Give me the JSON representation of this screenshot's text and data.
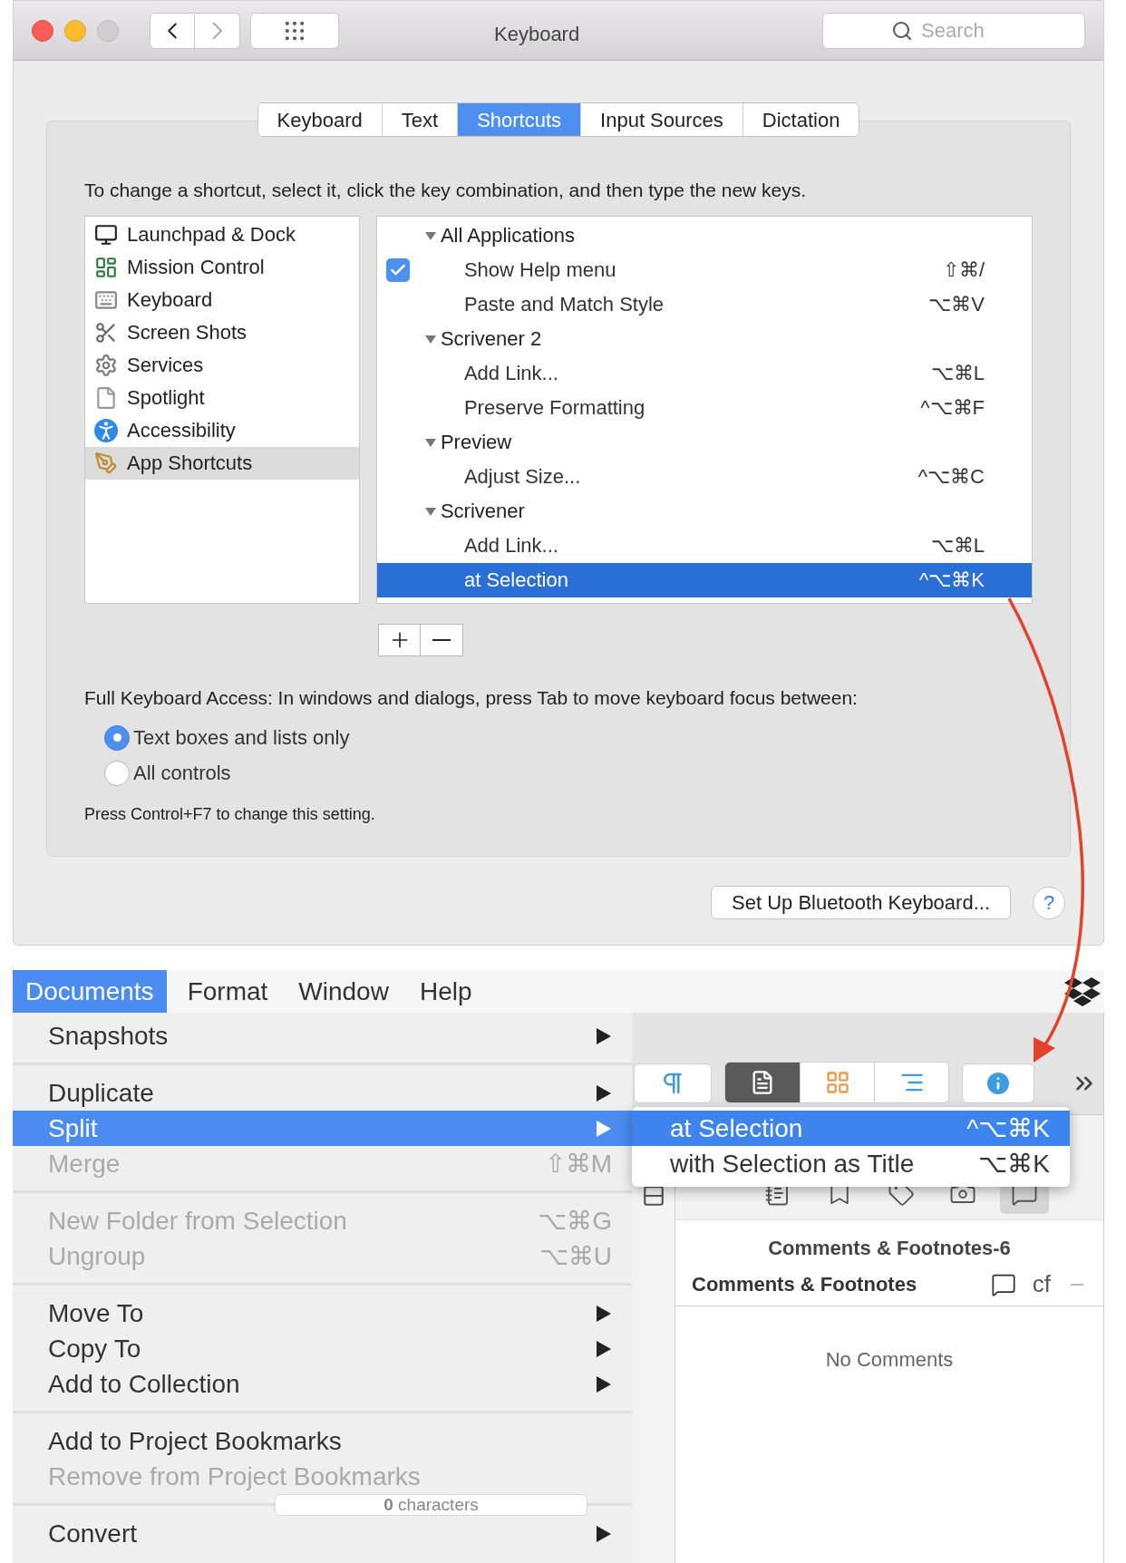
{
  "window": {
    "title": "Keyboard",
    "search": {
      "placeholder": "Search"
    }
  },
  "tabs": [
    {
      "label": "Keyboard",
      "selected": false
    },
    {
      "label": "Text",
      "selected": false
    },
    {
      "label": "Shortcuts",
      "selected": true
    },
    {
      "label": "Input Sources",
      "selected": false
    },
    {
      "label": "Dictation",
      "selected": false
    }
  ],
  "instructions": "To change a shortcut, select it, click the key combination, and then type the new keys.",
  "categories": [
    {
      "label": "Launchpad & Dock",
      "selected": false
    },
    {
      "label": "Mission Control",
      "selected": false
    },
    {
      "label": "Keyboard",
      "selected": false
    },
    {
      "label": "Screen Shots",
      "selected": false
    },
    {
      "label": "Services",
      "selected": false
    },
    {
      "label": "Spotlight",
      "selected": false
    },
    {
      "label": "Accessibility",
      "selected": false
    },
    {
      "label": "App Shortcuts",
      "selected": true
    }
  ],
  "shortcuts": [
    {
      "label": "All Applications",
      "expanded": true,
      "children": [
        {
          "label": "Show Help menu",
          "keys": "⇧⌘/",
          "checked": true,
          "selected": false
        },
        {
          "label": "Paste and Match Style",
          "keys": "⌥⌘V",
          "checked": false,
          "selected": false
        }
      ]
    },
    {
      "label": "Scrivener 2",
      "expanded": true,
      "children": [
        {
          "label": "Add Link...",
          "keys": "⌥⌘L",
          "checked": false,
          "selected": false
        },
        {
          "label": "Preserve Formatting",
          "keys": "^⌥⌘F",
          "checked": false,
          "selected": false
        }
      ]
    },
    {
      "label": "Preview",
      "expanded": true,
      "children": [
        {
          "label": "Adjust Size...",
          "keys": "^⌥⌘C",
          "checked": false,
          "selected": false
        }
      ]
    },
    {
      "label": "Scrivener",
      "expanded": true,
      "children": [
        {
          "label": "Add Link...",
          "keys": "⌥⌘L",
          "checked": false,
          "selected": false
        },
        {
          "label": "at Selection",
          "keys": "^⌥⌘K",
          "checked": false,
          "selected": true
        }
      ]
    }
  ],
  "access": {
    "label": "Full Keyboard Access: In windows and dialogs, press Tab to move keyboard focus between:",
    "options": [
      {
        "label": "Text boxes and lists only",
        "selected": true
      },
      {
        "label": "All controls",
        "selected": false
      }
    ],
    "hint": "Press Control+F7 to change this setting."
  },
  "bluetooth_button": "Set Up Bluetooth Keyboard...",
  "help_button": "?",
  "menu_bar": [
    {
      "label": "Documents",
      "selected": true
    },
    {
      "label": "Format",
      "selected": false
    },
    {
      "label": "Window",
      "selected": false
    },
    {
      "label": "Help",
      "selected": false
    }
  ],
  "menu": [
    [
      {
        "label": "Snapshots",
        "submenu": true,
        "disabled": false,
        "selected": false
      }
    ],
    [
      {
        "label": "Duplicate",
        "submenu": true,
        "disabled": false,
        "selected": false
      },
      {
        "label": "Split",
        "submenu": true,
        "disabled": false,
        "selected": true
      },
      {
        "label": "Merge",
        "shortcut": "⇧⌘M",
        "submenu": false,
        "disabled": true,
        "selected": false
      }
    ],
    [
      {
        "label": "New Folder from Selection",
        "shortcut": "⌥⌘G",
        "submenu": false,
        "disabled": true,
        "selected": false
      },
      {
        "label": "Ungroup",
        "shortcut": "⌥⌘U",
        "submenu": false,
        "disabled": true,
        "selected": false
      }
    ],
    [
      {
        "label": "Move To",
        "submenu": true,
        "disabled": false,
        "selected": false
      },
      {
        "label": "Copy To",
        "submenu": true,
        "disabled": false,
        "selected": false
      },
      {
        "label": "Add to Collection",
        "submenu": true,
        "disabled": false,
        "selected": false
      }
    ],
    [
      {
        "label": "Add to Project Bookmarks",
        "submenu": false,
        "disabled": false,
        "selected": false
      },
      {
        "label": "Remove from Project Bookmarks",
        "submenu": false,
        "disabled": true,
        "selected": false
      }
    ],
    [
      {
        "label": "Convert",
        "submenu": true,
        "disabled": false,
        "selected": false
      }
    ]
  ],
  "submenu": [
    {
      "label": "at Selection",
      "shortcut": "^⌥⌘K",
      "selected": true
    },
    {
      "label": "with Selection as Title",
      "shortcut": "⌥⌘K",
      "selected": false
    }
  ],
  "view_modes": [
    {
      "selected": true
    },
    {
      "selected": false
    },
    {
      "selected": false
    }
  ],
  "inspector_tabs": [
    {
      "selected": false
    },
    {
      "selected": false
    },
    {
      "selected": false
    },
    {
      "selected": false
    },
    {
      "selected": true
    }
  ],
  "inspector": {
    "title": "Comments & Footnotes-6",
    "header": "Comments & Footnotes",
    "header_tag": "cf",
    "empty": "No Comments"
  },
  "status": "**0** characters"
}
